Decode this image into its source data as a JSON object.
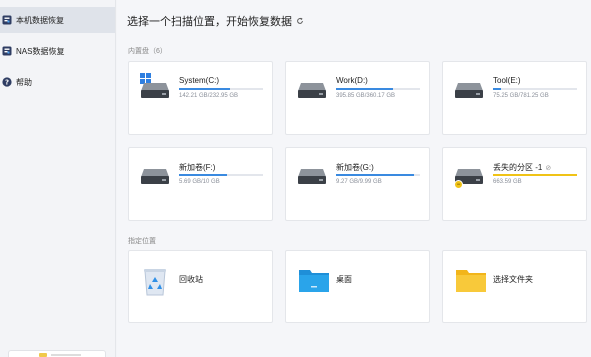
{
  "sidebar": {
    "items": [
      {
        "label": "本机数据恢复",
        "icon": "local-recovery-icon",
        "active": true
      },
      {
        "label": "NAS数据恢复",
        "icon": "nas-recovery-icon",
        "active": false
      },
      {
        "label": "帮助",
        "icon": "help-icon",
        "active": false
      }
    ]
  },
  "main": {
    "title": "选择一个扫描位置，开始恢复数据",
    "disks_section": "内置盘（6）",
    "locations_section": "指定位置",
    "disks": [
      {
        "name": "System(C:)",
        "size": "142.21 GB/232.95 GB",
        "used_fraction": 0.61,
        "bar_color": "blue"
      },
      {
        "name": "Work(D:)",
        "size": "395.85 GB/360.17 GB",
        "used_fraction": 0.68,
        "bar_color": "blue"
      },
      {
        "name": "Tool(E:)",
        "size": "75.25 GB/781.25 GB",
        "used_fraction": 0.1,
        "bar_color": "blue"
      },
      {
        "name": "新加卷(F:)",
        "size": "5.69 GB/10 GB",
        "used_fraction": 0.57,
        "bar_color": "blue"
      },
      {
        "name": "新加卷(G:)",
        "size": "9.27 GB/9.99 GB",
        "used_fraction": 0.93,
        "bar_color": "blue"
      },
      {
        "name": "丢失的分区 -1",
        "size": "663.59 GB",
        "used_fraction": 1.0,
        "bar_color": "yellow"
      }
    ],
    "locations": [
      {
        "name": "回收站",
        "icon": "recycle-bin-icon"
      },
      {
        "name": "桌面",
        "icon": "desktop-folder-icon"
      },
      {
        "name": "选择文件夹",
        "icon": "folder-icon"
      }
    ]
  },
  "colors": {
    "accent_blue": "#3a8ae0",
    "lost_yellow": "#f0c316",
    "active_nav_bg": "#dfe3ea"
  }
}
